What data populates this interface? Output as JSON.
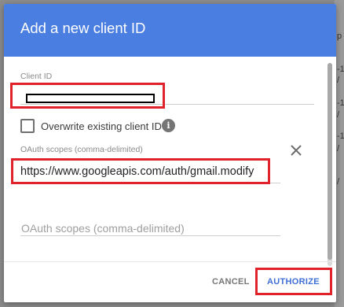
{
  "dialog": {
    "title": "Add a new client ID"
  },
  "client_id": {
    "label": "Client ID"
  },
  "overwrite": {
    "label": "Overwrite existing client ID",
    "checked": false,
    "info_icon": "info-icon"
  },
  "scopes": [
    {
      "label": "OAuth scopes (comma-delimited)",
      "value": "https://www.googleapis.com/auth/gmail.modify",
      "remove_icon": "close-icon"
    },
    {
      "placeholder": "OAuth scopes (comma-delimited)",
      "value": ""
    }
  ],
  "footer": {
    "cancel_label": "CANCEL",
    "authorize_label": "AUTHORIZE"
  },
  "background_page": {
    "glyphs": [
      "p",
      "-1",
      "/",
      "-1",
      "/",
      "-1",
      "/",
      "/"
    ]
  },
  "colors": {
    "header": "#4a7ee0",
    "primary_button": "#3f6fd6",
    "annotation_highlight": "#e0232b"
  }
}
